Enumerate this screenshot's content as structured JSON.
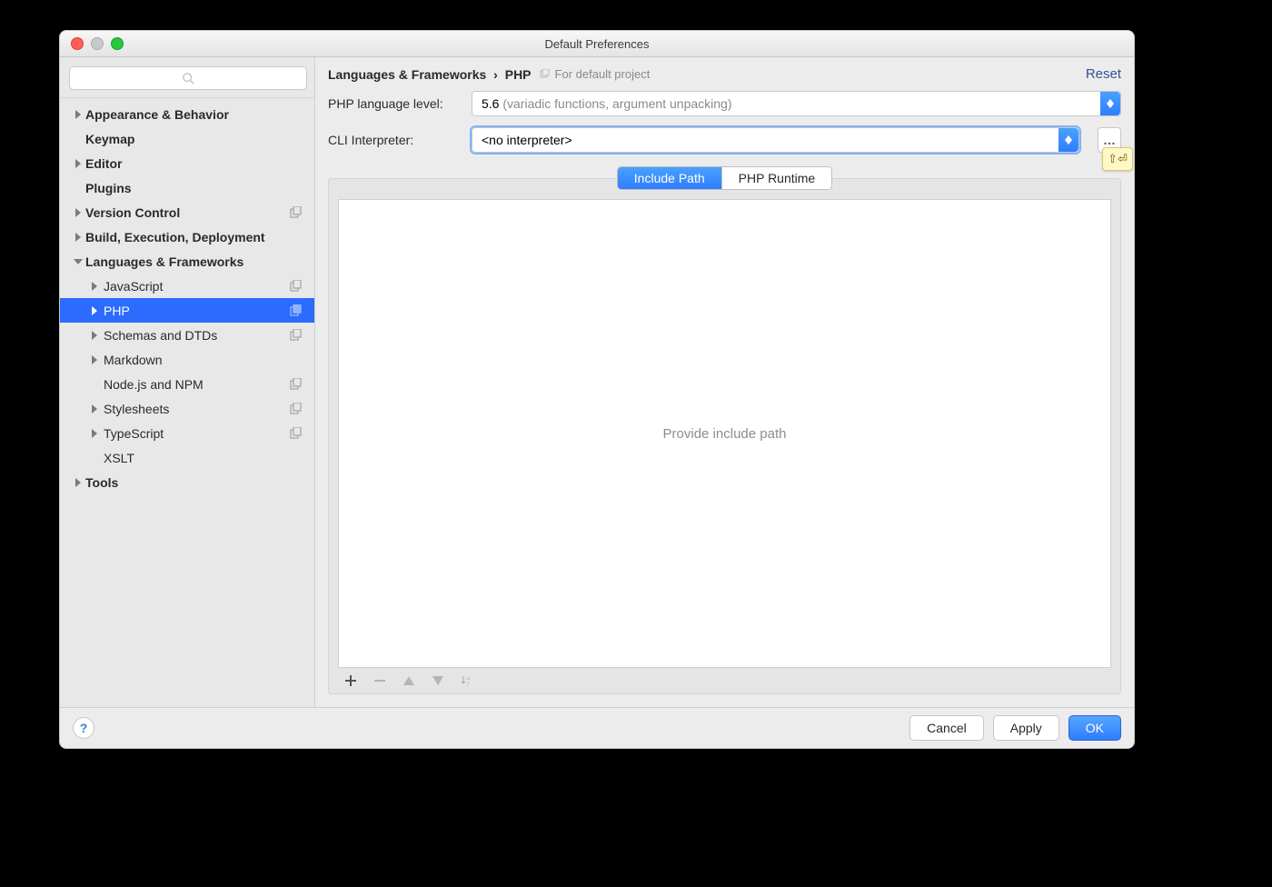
{
  "window": {
    "title": "Default Preferences"
  },
  "sidebar": {
    "search_placeholder": "",
    "items": [
      {
        "label": "Appearance & Behavior",
        "arrow": "right",
        "bold": true
      },
      {
        "label": "Keymap",
        "arrow": "none",
        "bold": true
      },
      {
        "label": "Editor",
        "arrow": "right",
        "bold": true
      },
      {
        "label": "Plugins",
        "arrow": "none",
        "bold": true
      },
      {
        "label": "Version Control",
        "arrow": "right",
        "bold": true,
        "dup": true
      },
      {
        "label": "Build, Execution, Deployment",
        "arrow": "right",
        "bold": true
      },
      {
        "label": "Languages & Frameworks",
        "arrow": "down",
        "bold": true
      },
      {
        "label": "JavaScript",
        "arrow": "right",
        "child": true,
        "dup": true
      },
      {
        "label": "PHP",
        "arrow": "right",
        "child": true,
        "dup": true,
        "selected": true
      },
      {
        "label": "Schemas and DTDs",
        "arrow": "right",
        "child": true,
        "dup": true
      },
      {
        "label": "Markdown",
        "arrow": "right",
        "child": true
      },
      {
        "label": "Node.js and NPM",
        "arrow": "none",
        "child": true,
        "dup": true
      },
      {
        "label": "Stylesheets",
        "arrow": "right",
        "child": true,
        "dup": true
      },
      {
        "label": "TypeScript",
        "arrow": "right",
        "child": true,
        "dup": true
      },
      {
        "label": "XSLT",
        "arrow": "none",
        "child": true
      },
      {
        "label": "Tools",
        "arrow": "right",
        "bold": true
      }
    ]
  },
  "breadcrumb": {
    "section": "Languages & Frameworks",
    "page": "PHP",
    "project_note": "For default project",
    "reset_label": "Reset"
  },
  "form": {
    "lang_level_label": "PHP language level:",
    "lang_level_value_main": "5.6",
    "lang_level_value_muted": "(variadic functions, argument unpacking)",
    "cli_label": "CLI Interpreter:",
    "cli_value": "<no interpreter>"
  },
  "callout": {
    "shift_enter_glyphs": "⇧⏎"
  },
  "tabs": {
    "items": [
      {
        "label": "Include Path",
        "active": true
      },
      {
        "label": "PHP Runtime",
        "active": false
      }
    ],
    "empty_text": "Provide include path"
  },
  "footer": {
    "help": "?",
    "cancel": "Cancel",
    "apply": "Apply",
    "ok": "OK"
  }
}
